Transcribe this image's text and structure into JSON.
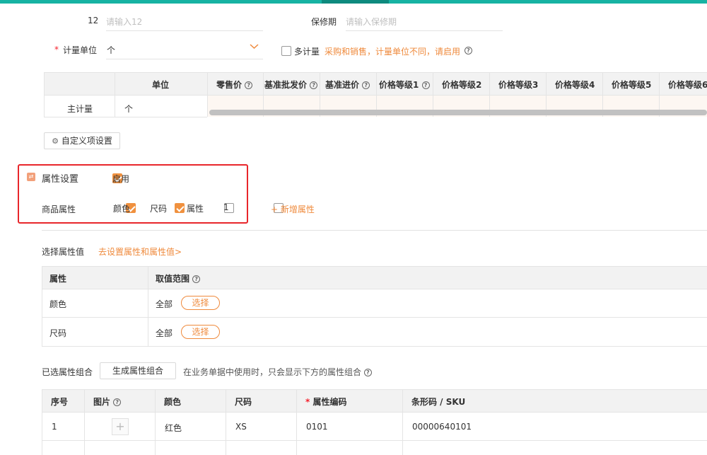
{
  "form": {
    "field12_label": "12",
    "field12_placeholder": "请输入12",
    "warranty_label": "保修期",
    "warranty_placeholder": "请输入保修期",
    "unit_required_mark": "*",
    "unit_label": "计量单位",
    "unit_value": "个",
    "multi_unit_label": "多计量",
    "multi_unit_checked": false,
    "multi_unit_hint": "采购和销售，计量单位不同，请启用"
  },
  "price_table": {
    "headers": [
      "单位",
      "零售价",
      "基准批发价",
      "基准进价",
      "价格等级1",
      "价格等级2",
      "价格等级3",
      "价格等级4",
      "价格等级5",
      "价格等级6"
    ],
    "header_help": [
      false,
      true,
      true,
      true,
      true,
      false,
      false,
      false,
      false,
      false
    ],
    "row_label": "主计量",
    "row_unit": "个"
  },
  "custom_settings_button": "自定义项设置",
  "attributes": {
    "section_title": "属性设置",
    "enable_label": "启用",
    "enable_checked": true,
    "product_attr_label": "商品属性",
    "options": [
      {
        "label": "颜色",
        "checked": true
      },
      {
        "label": "尺码",
        "checked": true
      },
      {
        "label": "属性",
        "checked": false
      },
      {
        "label": "1",
        "checked": false
      }
    ],
    "add_attr_label": "+ 新增属性"
  },
  "attr_values": {
    "select_label": "选择属性值",
    "goto_link": "去设置属性和属性值>",
    "col_attr": "属性",
    "col_range": "取值范围",
    "rows": [
      {
        "attr": "颜色",
        "range": "全部",
        "action": "选择"
      },
      {
        "attr": "尺码",
        "range": "全部",
        "action": "选择"
      }
    ]
  },
  "combos": {
    "label": "已选属性组合",
    "generate_button": "生成属性组合",
    "hint": "在业务单据中使用时，只会显示下方的属性组合",
    "headers": [
      "序号",
      "图片",
      "颜色",
      "尺码",
      "属性编码",
      "条形码 / SKU"
    ],
    "required_mark": "*",
    "rows": [
      {
        "index": "1",
        "color": "红色",
        "size": "XS",
        "code": "0101",
        "barcode": "00000640101"
      }
    ]
  },
  "colors": {
    "accent": "#ef8a3c",
    "teal": "#17b3a3",
    "highlight_border": "#e8262b"
  }
}
